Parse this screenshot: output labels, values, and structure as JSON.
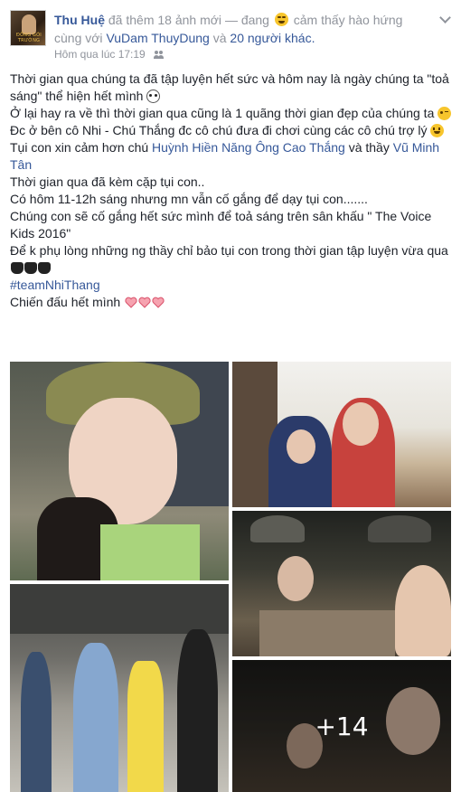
{
  "post": {
    "author": "Thu Huệ",
    "action_text": "đã thêm",
    "photo_count_text": "18 ảnh mới",
    "separator": "— đang",
    "feeling_text": "cảm thấy hào hứng",
    "with_text": "cùng với",
    "tagged_friend": "VuDam ThuyDung",
    "and_text": "và",
    "others_link": "20 người khác.",
    "timestamp": "Hôm qua lúc 17:19",
    "avatar_caption": "ĐỒNG GÓI TRƯỜNG",
    "menu_icon": "chevron-down-icon",
    "audience_icon": "friends-icon",
    "body": [
      "Thời gian qua chúng ta đã tập luyện hết sức và hôm nay là ngày chúng ta \"toả sáng\" thể hiện hết mình",
      "Ở lại hay ra về thì thời gian qua cũng là 1 quãng thời gian đẹp của chúng ta",
      "Đc ở bên cô Nhi - Chú Thắng đc cô chú đưa đi chơi cùng các cô chú trợ lý",
      "Tụi con xin cảm hơn chú",
      "Huỳnh Hiền Năng",
      "Ông Cao Thắng",
      "và thầy",
      "Vũ Minh Tân",
      "Thời gian qua đã kèm cặp tụi con..",
      "Có hôm 11-12h sáng nhưng mn vẫn cố gắng để dạy tụi con.......",
      "Chúng con sẽ cố gắng hết sức mình để toả sáng trên sân khấu \" The Voice Kids 2016\"",
      "Để k phụ lòng những ng thầy chỉ bảo tụi con trong thời gian tập luyện vừa qua",
      "#teamNhiThang",
      "Chiến đấu hết mình"
    ],
    "more_photos_label": "+14"
  },
  "colors": {
    "link": "#365899",
    "meta": "#90949c",
    "text": "#1d2129"
  }
}
